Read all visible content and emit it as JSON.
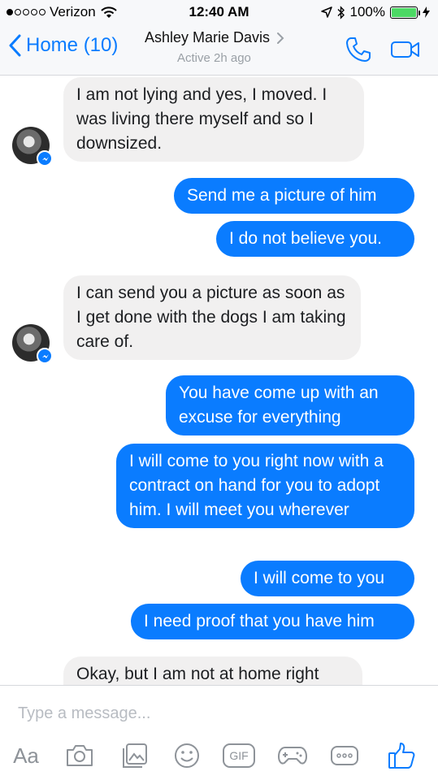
{
  "status_bar": {
    "carrier": "Verizon",
    "time": "12:40 AM",
    "battery": "100%",
    "battery_level": 1.0
  },
  "header": {
    "back_label": "Home (10)",
    "contact_name": "Ashley Marie Davis",
    "presence": "Active 2h ago"
  },
  "messages": [
    {
      "from": "them",
      "text": "I am not lying and yes, I moved. I was living there myself and so I downsized."
    },
    {
      "from": "me",
      "text": "Send me a picture of him"
    },
    {
      "from": "me",
      "text": "I do not believe you."
    },
    {
      "from": "them",
      "text": "I can send you a picture as soon as I get done with the dogs I am taking care of."
    },
    {
      "from": "me",
      "text": "You have come up with an excuse for everything"
    },
    {
      "from": "me",
      "text": "I will come to you right now with a contract on hand for you to adopt him. I will meet you wherever"
    },
    {
      "from": "me",
      "text": "I will come to you"
    },
    {
      "from": "me",
      "text": "I need proof that you have him"
    },
    {
      "from": "them",
      "text": "Okay, but I am not at home right"
    }
  ],
  "composer": {
    "placeholder": "Type a message...",
    "text_format_label": "Aa",
    "gif_label": "GIF"
  },
  "colors": {
    "accent": "#0a7cff",
    "incoming_bubble": "#f1f0f0",
    "bar_background": "#f7f8fa"
  }
}
